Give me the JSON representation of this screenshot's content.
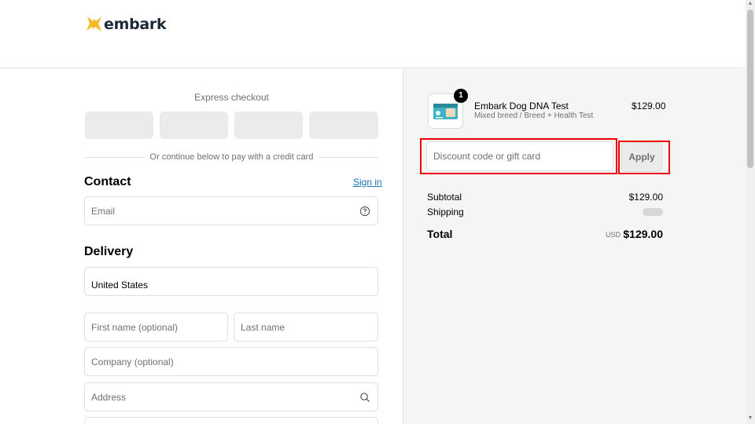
{
  "brand": {
    "name": "embark"
  },
  "express": {
    "title": "Express checkout",
    "divider_text": "Or continue below to pay with a credit card"
  },
  "contact": {
    "heading": "Contact",
    "sign_in": "Sign in",
    "email_placeholder": "Email"
  },
  "delivery": {
    "heading": "Delivery",
    "country": "United States",
    "first_name_placeholder": "First name (optional)",
    "last_name_placeholder": "Last name",
    "company_placeholder": "Company (optional)",
    "address_placeholder": "Address"
  },
  "cart": {
    "quantity": "1",
    "product_name": "Embark Dog DNA Test",
    "variant": "Mixed breed / Breed + Health Test",
    "price": "$129.00"
  },
  "discount": {
    "placeholder": "Discount code or gift card",
    "apply_label": "Apply"
  },
  "summary": {
    "subtotal_label": "Subtotal",
    "subtotal_value": "$129.00",
    "shipping_label": "Shipping",
    "total_label": "Total",
    "currency": "USD",
    "total_value": "$129.00"
  },
  "colors": {
    "logo_accent": "#f5b820",
    "link": "#1773b0",
    "highlight": "#e00000"
  }
}
